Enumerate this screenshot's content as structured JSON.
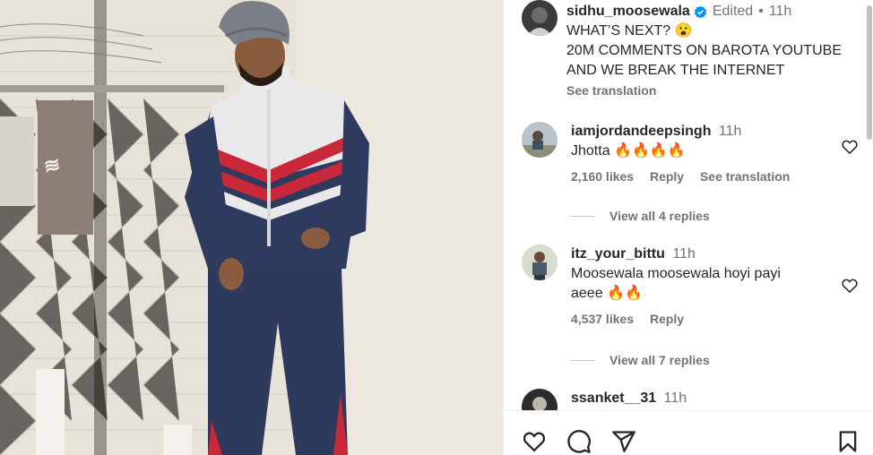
{
  "post": {
    "author": "sidhu_moosewala",
    "edited": "Edited",
    "dot": "•",
    "time": "11h",
    "caption_line1": "WHAT’S NEXT? 😮",
    "caption_line2": "20M COMMENTS ON BAROTA YOUTUBE AND WE BREAK THE INTERNET",
    "see_translation": "See translation"
  },
  "comments": [
    {
      "user": "iamjordandeepsingh",
      "time": "11h",
      "text": "Jhotta 🔥🔥🔥🔥",
      "likes": "2,160 likes",
      "reply": "Reply",
      "translate": "See translation",
      "view_replies": "View all 4 replies"
    },
    {
      "user": "itz_your_bittu",
      "time": "11h",
      "text": "Moosewala moosewala hoyi payi aeee 🔥🔥",
      "likes": "4,537 likes",
      "reply": "Reply",
      "view_replies": "View all 7 replies"
    },
    {
      "user": "ssanket__31",
      "time": "11h"
    }
  ],
  "icons": {
    "like": "heart-icon",
    "comment": "comment-icon",
    "share": "share-icon",
    "save": "bookmark-icon",
    "verified": "verified-badge-icon"
  },
  "colors": {
    "verified_blue": "#0095f6",
    "muted": "#737373",
    "text": "#262626"
  }
}
